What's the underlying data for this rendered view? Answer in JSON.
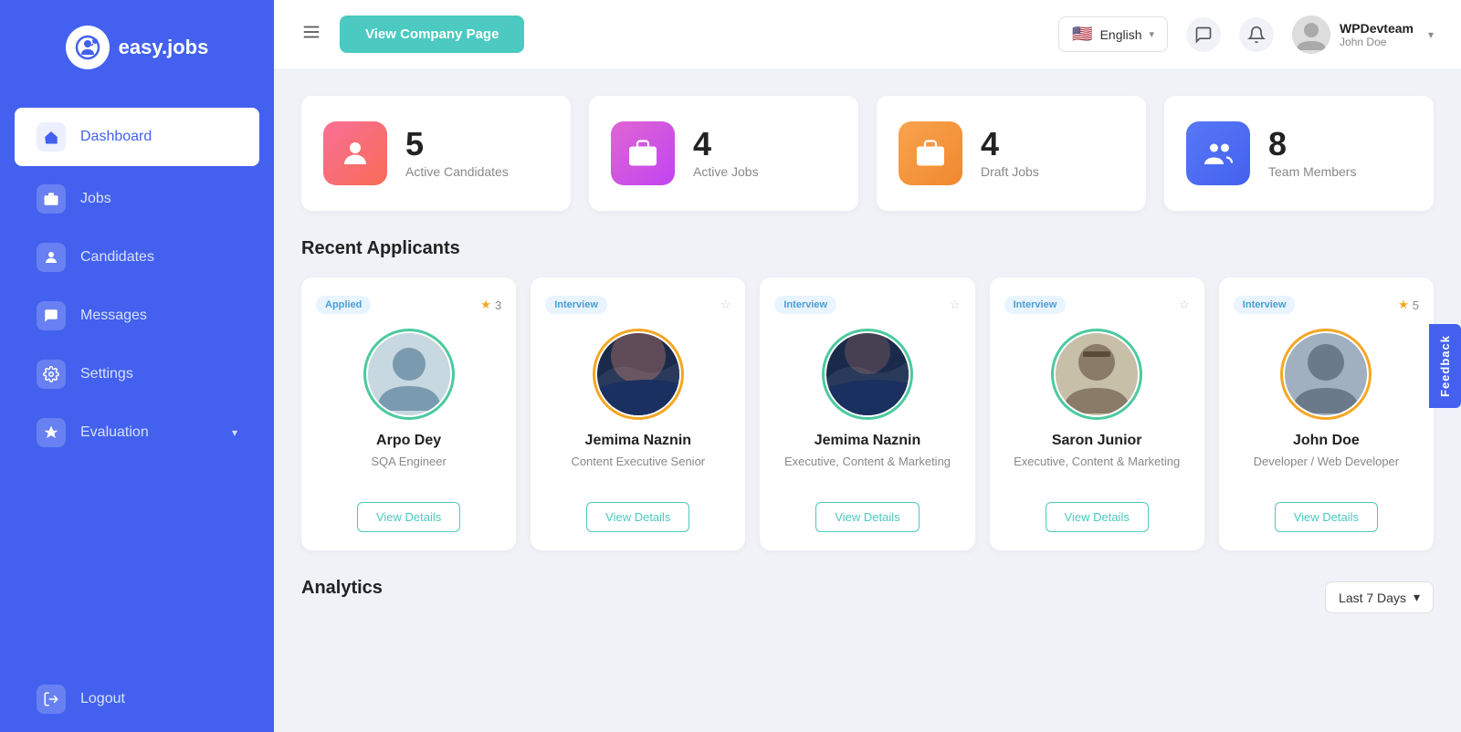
{
  "sidebar": {
    "logo_text": "easy.jobs",
    "nav_items": [
      {
        "id": "dashboard",
        "label": "Dashboard",
        "icon": "🏠",
        "active": true
      },
      {
        "id": "jobs",
        "label": "Jobs",
        "icon": "💼",
        "active": false
      },
      {
        "id": "candidates",
        "label": "Candidates",
        "icon": "👤",
        "active": false
      },
      {
        "id": "messages",
        "label": "Messages",
        "icon": "💬",
        "active": false
      },
      {
        "id": "settings",
        "label": "Settings",
        "icon": "⚙️",
        "active": false
      },
      {
        "id": "evaluation",
        "label": "Evaluation",
        "icon": "🎓",
        "active": false,
        "has_chevron": true
      }
    ],
    "logout_label": "Logout"
  },
  "header": {
    "company_page_btn": "View Company Page",
    "language": "English",
    "user_name": "WPDevteam",
    "user_sub": "John Doe"
  },
  "stats": [
    {
      "id": "active-candidates",
      "number": "5",
      "label": "Active Candidates",
      "icon_type": "pink",
      "icon": "👤"
    },
    {
      "id": "active-jobs",
      "number": "4",
      "label": "Active Jobs",
      "icon_type": "purple",
      "icon": "💼"
    },
    {
      "id": "draft-jobs",
      "number": "4",
      "label": "Draft Jobs",
      "icon_type": "orange",
      "icon": "💼"
    },
    {
      "id": "team-members",
      "number": "8",
      "label": "Team Members",
      "icon_type": "blue",
      "icon": "👥"
    }
  ],
  "recent_applicants": {
    "title": "Recent Applicants",
    "cards": [
      {
        "id": "arpo-dey",
        "name": "Arpo Dey",
        "role": "SQA Engineer",
        "status": "Applied",
        "status_type": "applied",
        "rating": "3",
        "has_rating": true,
        "ring": "green-ring",
        "view_details": "View Details"
      },
      {
        "id": "jemima-naznin-1",
        "name": "Jemima Naznin",
        "role": "Content Executive Senior",
        "status": "Interview",
        "status_type": "interview",
        "rating": "",
        "has_rating": false,
        "ring": "orange-ring",
        "view_details": "View Details"
      },
      {
        "id": "jemima-naznin-2",
        "name": "Jemima Naznin",
        "role": "Executive, Content & Marketing",
        "status": "Interview",
        "status_type": "interview",
        "rating": "",
        "has_rating": false,
        "ring": "green-ring",
        "view_details": "View Details"
      },
      {
        "id": "saron-junior",
        "name": "Saron Junior",
        "role": "Executive, Content & Marketing",
        "status": "Interview",
        "status_type": "interview",
        "rating": "",
        "has_rating": false,
        "ring": "green-ring",
        "view_details": "View Details"
      },
      {
        "id": "john-doe",
        "name": "John Doe",
        "role": "Developer / Web Developer",
        "status": "Interview",
        "status_type": "interview",
        "rating": "5",
        "has_rating": true,
        "ring": "orange-ring",
        "view_details": "View Details"
      }
    ]
  },
  "analytics": {
    "title": "Analytics",
    "filter_label": "Last 7 Days",
    "filter_icon": "chevron-down"
  },
  "feedback": {
    "label": "Feedback"
  }
}
